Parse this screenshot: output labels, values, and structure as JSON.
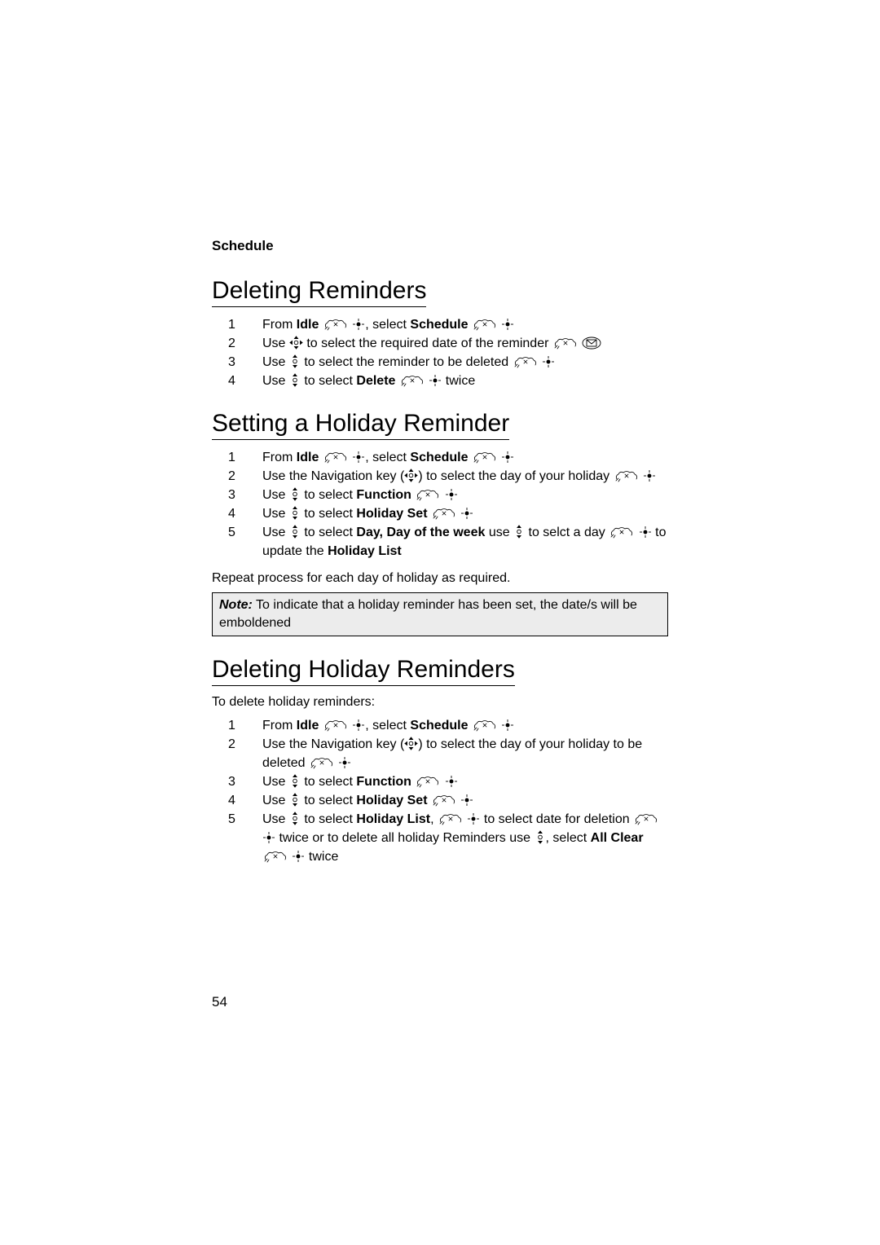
{
  "breadcrumb": "Schedule",
  "section1": {
    "title": "Deleting Reminders",
    "steps": {
      "s1a": "From ",
      "s1b": "Idle",
      "s1c": ", select ",
      "s1d": "Schedule",
      "s2a": "Use ",
      "s2b": " to select the required date of the reminder ",
      "s3a": "Use ",
      "s3b": " to select the reminder to be deleted ",
      "s4a": "Use ",
      "s4b": " to select ",
      "s4c": "Delete",
      "s4d": " twice"
    }
  },
  "section2": {
    "title": "Setting a Holiday Reminder",
    "steps": {
      "s1a": "From ",
      "s1b": "Idle",
      "s1c": ", select ",
      "s1d": "Schedule",
      "s2a": "Use the Navigation key (",
      "s2b": ") to select the day of your holiday ",
      "s3a": "Use ",
      "s3b": " to select ",
      "s3c": "Function",
      "s4a": "Use ",
      "s4b": " to select ",
      "s4c": "Holiday Set",
      "s5a": "Use ",
      "s5b": " to select ",
      "s5c": "Day, Day of the week",
      "s5d": " use ",
      "s5e": " to selct a day ",
      "s5f": " to update the ",
      "s5g": "Holiday List"
    },
    "para": "Repeat process for each day of holiday as required.",
    "note_label": "Note:",
    "note_body": " To indicate that a holiday reminder has been set, the date/s will be emboldened"
  },
  "section3": {
    "title": "Deleting Holiday Reminders",
    "intro": "To delete holiday reminders:",
    "steps": {
      "s1a": "From ",
      "s1b": "Idle",
      "s1c": ", select ",
      "s1d": "Schedule",
      "s2a": "Use the Navigation key (",
      "s2b": ") to select the day of your holiday to be deleted ",
      "s3a": "Use ",
      "s3b": " to select ",
      "s3c": "Function",
      "s4a": "Use ",
      "s4b": " to select ",
      "s4c": "Holiday Set",
      "s5a": "Use ",
      "s5b": " to select ",
      "s5c": "Holiday List",
      "s5d": ", ",
      "s5e": " to select date for deletion ",
      "s5f": " twice or to delete all holiday Reminders use ",
      "s5g": ", select ",
      "s5h": "All Clear",
      "s5i": " twice"
    }
  },
  "page_number": "54",
  "nums": {
    "n1": "1",
    "n2": "2",
    "n3": "3",
    "n4": "4",
    "n5": "5"
  }
}
